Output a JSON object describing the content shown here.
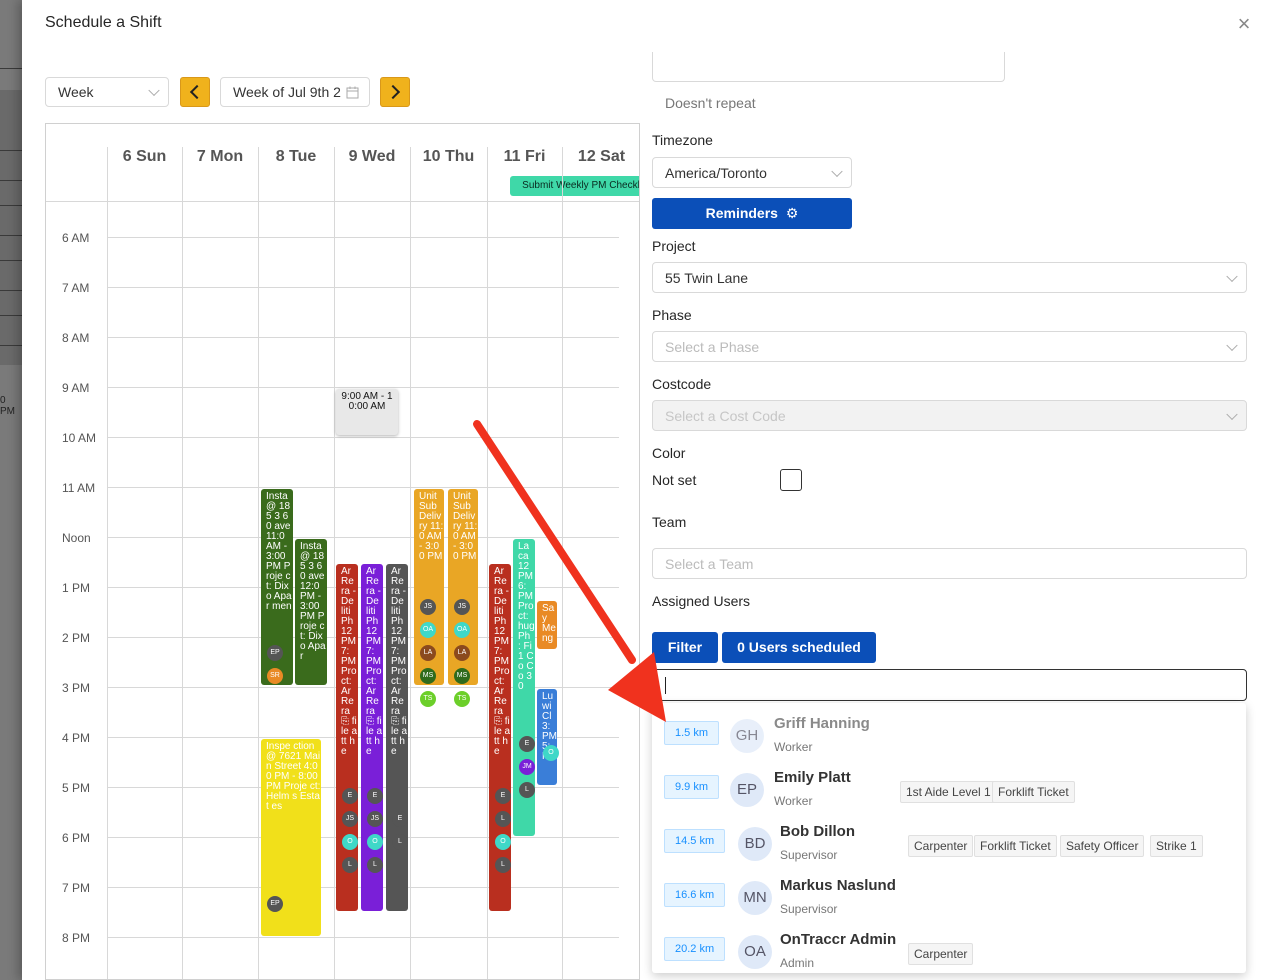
{
  "header": {
    "title": "Schedule a Shift",
    "close_label": "×"
  },
  "backdrop": {
    "text": "0 PM"
  },
  "calendar": {
    "view_select": "Week",
    "week_label": "Week of Jul 9th 2",
    "days": [
      "6 Sun",
      "7 Mon",
      "8 Tue",
      "9 Wed",
      "10 Thu",
      "11 Fri",
      "12 Sat"
    ],
    "hours": [
      "6 AM",
      "7 AM",
      "8 AM",
      "9 AM",
      "10 AM",
      "11 AM",
      "Noon",
      "1 PM",
      "2 PM",
      "3 PM",
      "4 PM",
      "5 PM",
      "6 PM",
      "7 PM",
      "8 PM"
    ],
    "allday_event": "Submit Weekly PM Checklist",
    "events": [
      {
        "text": "Insta @ 185 3 60 ave 11:0 AM - 3:00 PM Proje ct: Dixo Apar men",
        "color": "#3a6b1c",
        "avatars": [
          "EP",
          "SR"
        ]
      },
      {
        "text": "Insta @ 185 3 60 ave 12:0 PM - 3:00 PM Proje ct: Dixo Apar",
        "color": "#3a6b1c",
        "avatars": []
      },
      {
        "text": "9:00 AM - 10:00 AM",
        "color": "#e8e8e8",
        "avatars": []
      },
      {
        "text": "Inspe ction @ 7621 Main Street 4:00 PM - 8:00 PM Proje ct: Helm s Estat es",
        "color": "#f1e01a",
        "avatars": [
          "EP"
        ]
      },
      {
        "text": "Ar Re ra - De liti Ph 12 PM 7: PM Pro ct: Ar Re ra ⎘ file att he",
        "color": "#b92f1f",
        "avatars": [
          "E",
          "JS",
          "O",
          "L"
        ]
      },
      {
        "text": "Ar Re ra - De liti Ph 12 PM 7: PM Pro ct: Ar Re ra ⎘ file att he",
        "color": "#7a1fd8",
        "avatars": [
          "E",
          "JS",
          "O",
          "L"
        ]
      },
      {
        "text": "Ar Re ra - De liti Ph 12 PM 7: PM Pro ct: Ar Re ra ⎘ file att he",
        "color": "#555",
        "avatars": [
          "E",
          "L"
        ]
      },
      {
        "text": "Unit Sub Deliv ry 11:0 AM - 3:00 PM",
        "color": "#e9a625",
        "avatars": [
          "JS",
          "OA",
          "LA",
          "MS",
          "TS"
        ]
      },
      {
        "text": "Unit Sub Deliv ry 11:0 AM - 3:00 PM",
        "color": "#e9a625",
        "avatars": [
          "JS",
          "OA",
          "LA",
          "MS",
          "TS"
        ]
      },
      {
        "text": "Ar Re ra - De liti Ph 12 PM 7: PM Pro ct: Ar Re ra ⎘ file att he",
        "color": "#b92f1f",
        "avatars": [
          "E",
          "L",
          "O",
          "L"
        ]
      },
      {
        "text": "La ca 12 PM 6: PM Pro ct: hug Ph : Fi 1 Co Co 30",
        "color": "#3fd8a8",
        "avatars": [
          "E",
          "JM",
          "L"
        ]
      },
      {
        "text": "Sa y Me ng",
        "color": "#e98a25",
        "avatars": []
      },
      {
        "text": "Lu wi Cl 3: PM 5: PM",
        "color": "#3a7ed8",
        "avatars": [
          "O"
        ]
      }
    ]
  },
  "form": {
    "repeat_text": "Doesn't repeat",
    "timezone_label": "Timezone",
    "timezone_value": "America/Toronto",
    "reminders_label": "Reminders",
    "project_label": "Project",
    "project_value": "55 Twin Lane",
    "phase_label": "Phase",
    "phase_placeholder": "Select a Phase",
    "costcode_label": "Costcode",
    "costcode_placeholder": "Select a Cost Code",
    "color_label": "Color",
    "color_value": "Not set",
    "team_label": "Team",
    "team_placeholder": "Select a Team",
    "assigned_label": "Assigned Users",
    "filter_label": "Filter",
    "scheduled_label": "0 Users scheduled",
    "search_value": ""
  },
  "users": [
    {
      "distance": "1.5 km",
      "initials": "GH",
      "name": "Griff Hanning",
      "role": "Worker",
      "tags": [],
      "dimmed": true
    },
    {
      "distance": "9.9 km",
      "initials": "EP",
      "name": "Emily Platt",
      "role": "Worker",
      "tags": [
        "1st Aide Level 1",
        "Forklift Ticket"
      ],
      "dimmed": false
    },
    {
      "distance": "14.5 km",
      "initials": "BD",
      "name": "Bob Dillon",
      "role": "Supervisor",
      "tags": [
        "Carpenter",
        "Forklift Ticket",
        "Safety Officer",
        "Strike 1"
      ],
      "dimmed": false
    },
    {
      "distance": "16.6 km",
      "initials": "MN",
      "name": "Markus Naslund",
      "role": "Supervisor",
      "tags": [],
      "dimmed": false
    },
    {
      "distance": "20.2 km",
      "initials": "OA",
      "name": "OnTraccr Admin",
      "role": "Admin",
      "tags": [
        "Carpenter"
      ],
      "dimmed": false
    }
  ],
  "colors": {
    "accent_yellow": "#f0b21c",
    "primary_blue": "#0b4fb8",
    "annotation_red": "#f0321e"
  }
}
